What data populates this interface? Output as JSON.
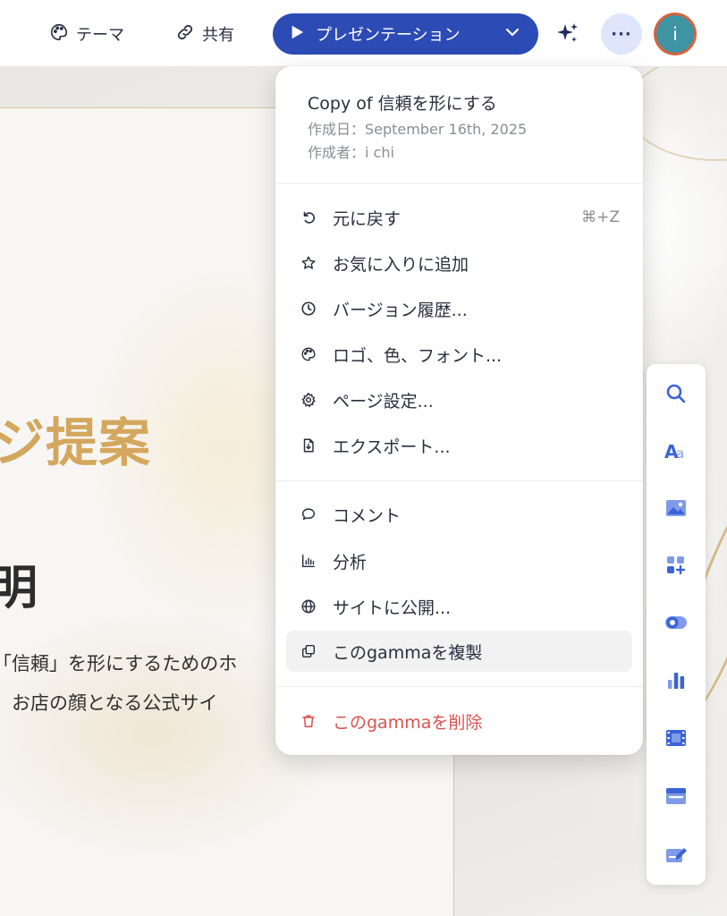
{
  "toolbar": {
    "theme_label": "テーマ",
    "share_label": "共有",
    "present_label": "プレゼンテーション",
    "more_label": "···",
    "avatar_initial": "i"
  },
  "slide": {
    "title_fragment": "ジ提案",
    "subtitle_fragment": "明",
    "body_line1": "「信頼」を形にするためのホ",
    "body_line2": "、お店の顔となる公式サイ"
  },
  "menu": {
    "doc_title": "Copy of 信頼を形にする",
    "created_date": "作成日：September 16th, 2025",
    "created_by": "作成者：i chi",
    "items": [
      {
        "label": "元に戻す",
        "icon": "undo-icon",
        "shortcut": "⌘+Z"
      },
      {
        "label": "お気に入りに追加",
        "icon": "star-icon"
      },
      {
        "label": "バージョン履歴...",
        "icon": "clock-icon"
      },
      {
        "label": "ロゴ、色、フォント...",
        "icon": "palette-icon"
      },
      {
        "label": "ページ設定...",
        "icon": "gear-icon"
      },
      {
        "label": "エクスポート...",
        "icon": "export-file-icon"
      },
      {
        "label": "コメント",
        "icon": "comment-icon"
      },
      {
        "label": "分析",
        "icon": "analytics-icon"
      },
      {
        "label": "サイトに公開...",
        "icon": "globe-icon"
      },
      {
        "label": "このgammaを複製",
        "icon": "duplicate-icon"
      },
      {
        "label": "このgammaを削除",
        "icon": "trash-icon"
      }
    ]
  },
  "right_tools": [
    "search-icon",
    "text-style-icon",
    "image-icon",
    "add-block-icon",
    "toggle-icon",
    "chart-icon",
    "video-icon",
    "card-layout-icon",
    "edit-form-icon"
  ],
  "colors": {
    "present_button": "#2d4bb4",
    "accent_gold": "#d3a75d",
    "danger": "#d9534f",
    "avatar_bg": "#3f94a3",
    "avatar_ring": "#d7633f"
  }
}
